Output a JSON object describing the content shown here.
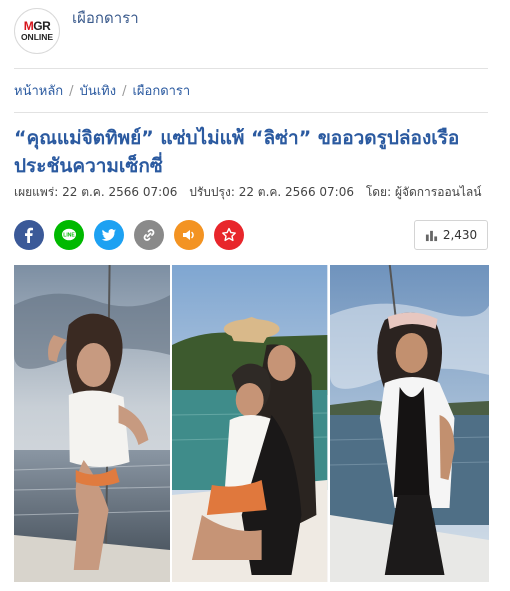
{
  "header": {
    "logo_line1_m": "M",
    "logo_line1_rest": "GR",
    "logo_line2": "ONLINE",
    "section": "เผือกดารา"
  },
  "breadcrumb": {
    "items": [
      "หน้าหลัก",
      "บันเทิง",
      "เผือกดารา"
    ],
    "separator": "/"
  },
  "article": {
    "title": "“คุณแม่จิตทิพย์” แซ่บไม่แพ้ “ลิซ่า” ขออวดรูปล่องเรือประชันความเซ็กซี่",
    "published": "เผยแพร่: 22 ต.ค. 2566 07:06",
    "updated": "ปรับปรุง: 22 ต.ค. 2566 07:06",
    "author": "โดย: ผู้จัดการออนไลน์"
  },
  "share": {
    "buttons": [
      {
        "name": "facebook",
        "icon": "facebook-icon",
        "color": "#3b5998"
      },
      {
        "name": "line",
        "icon": "line-icon",
        "color": "#00b900"
      },
      {
        "name": "twitter",
        "icon": "twitter-icon",
        "color": "#1da1f2"
      },
      {
        "name": "copy-link",
        "icon": "link-icon",
        "color": "#8a8a8a"
      },
      {
        "name": "listen",
        "icon": "speaker-icon",
        "color": "#f39322"
      },
      {
        "name": "bookmark",
        "icon": "star-icon",
        "color": "#e8262b"
      }
    ]
  },
  "stats": {
    "views": "2,430",
    "icon": "bar-chart-icon"
  },
  "gallery": {
    "photos": [
      "photo-woman-on-boat-white-top",
      "photo-two-women-on-boat",
      "photo-woman-black-swimsuit-on-boat"
    ]
  }
}
